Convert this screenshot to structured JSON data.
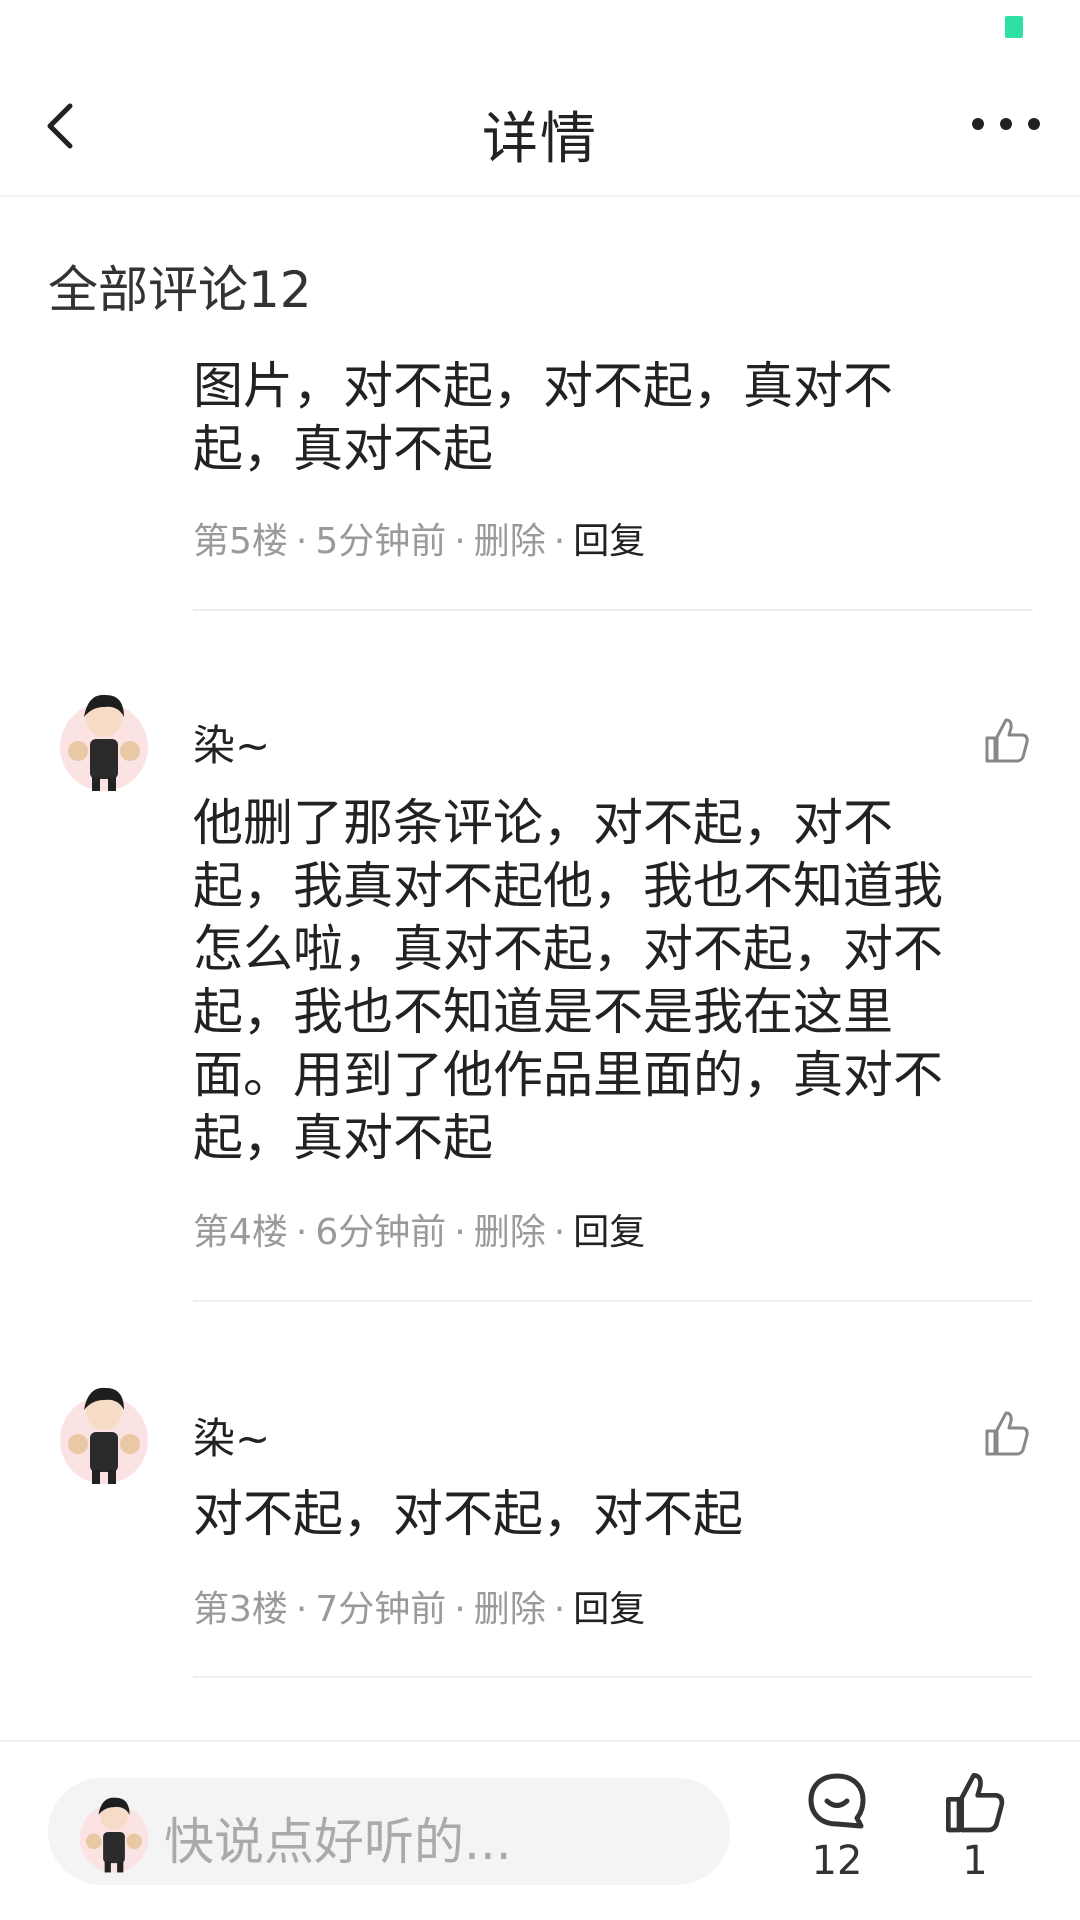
{
  "header": {
    "title": "详情"
  },
  "section_title": "全部评论12",
  "comments": [
    {
      "text": "图片，对不起，对不起，真对不起，真对不起",
      "floor": "第5楼",
      "time": "5分钟前",
      "delete": "删除",
      "reply": "回复"
    },
    {
      "user": "染~",
      "text": "他删了那条评论，对不起，对不起，我真对不起他，我也不知道我怎么啦，真对不起，对不起，对不起，我也不知道是不是我在这里面。用到了他作品里面的，真对不起，真对不起",
      "floor": "第4楼",
      "time": "6分钟前",
      "delete": "删除",
      "reply": "回复"
    },
    {
      "user": "染~",
      "text": "对不起，对不起，对不起",
      "floor": "第3楼",
      "time": "7分钟前",
      "delete": "删除",
      "reply": "回复"
    }
  ],
  "bottom": {
    "input_placeholder": "快说点好听的...",
    "comment_count": "12",
    "like_count": "1"
  },
  "icons": {
    "back": "back-arrow-icon",
    "more": "more-dots-icon",
    "like": "thumbs-up-icon",
    "comment": "comment-bubble-icon"
  },
  "colors": {
    "status_accent": "#2fe0a6",
    "meta_gray": "#9a9a9a"
  }
}
